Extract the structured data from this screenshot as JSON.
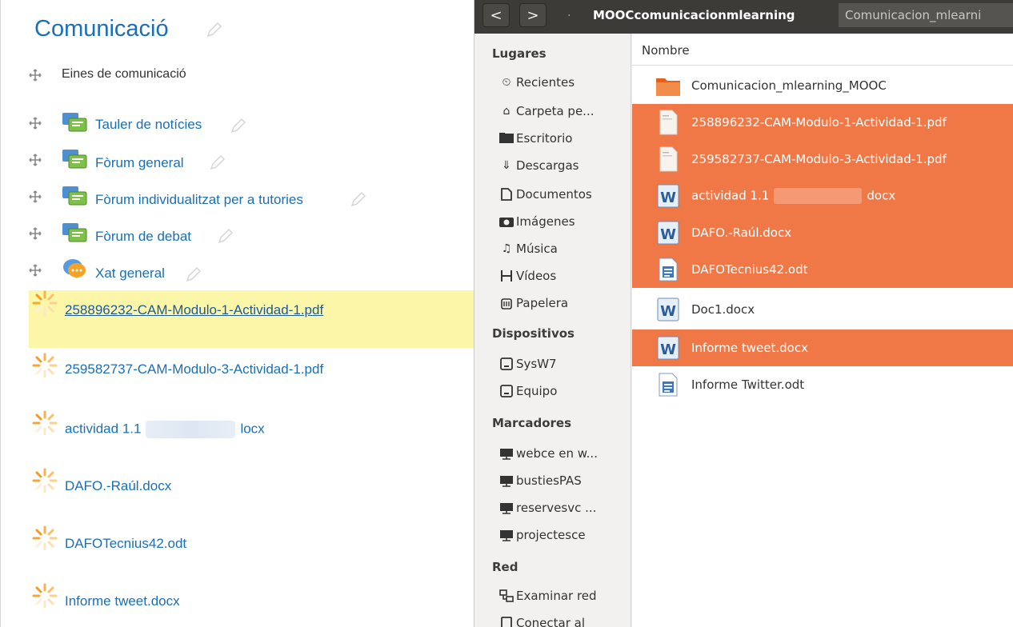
{
  "moodle": {
    "section_title": "Comunicació",
    "items": [
      {
        "label": "Eines de comunicació",
        "type": "label"
      },
      {
        "label": "Tauler de notícies",
        "type": "forum"
      },
      {
        "label": "Fòrum general",
        "type": "forum"
      },
      {
        "label": "Fòrum individualitzat per a tutories",
        "type": "forum"
      },
      {
        "label": "Fòrum de debat",
        "type": "forum"
      },
      {
        "label": "Xat general",
        "type": "chat"
      }
    ],
    "uploading_files": [
      {
        "label": "258896232-CAM-Modulo-1-Actividad-1.pdf"
      },
      {
        "label": "259582737-CAM-Modulo-3-Actividad-1.pdf"
      },
      {
        "label_start": "actividad 1.1",
        "label_end": "locx"
      },
      {
        "label": "DAFO.-Raúl.docx"
      },
      {
        "label": "DAFOTecnius42.odt"
      },
      {
        "label": "Informe tweet.docx"
      }
    ],
    "colors": {
      "link": "#1a6fb5",
      "highlight": "#fbf6a8"
    }
  },
  "file_manager": {
    "nav": {
      "back": "<",
      "forward": ">"
    },
    "breadcrumbs": [
      "MOOCcomunicacionmlearning",
      "Comunicacion_mlearni"
    ],
    "sidebar": {
      "sections": [
        {
          "heading": "Lugares",
          "items": [
            {
              "label": "Recientes",
              "icon": "clock-icon"
            },
            {
              "label": "Carpeta pe...",
              "icon": "home-icon"
            },
            {
              "label": "Escritorio",
              "icon": "desktop-icon"
            },
            {
              "label": "Descargas",
              "icon": "download-icon"
            },
            {
              "label": "Documentos",
              "icon": "document-icon"
            },
            {
              "label": "Imágenes",
              "icon": "camera-icon"
            },
            {
              "label": "Música",
              "icon": "music-icon"
            },
            {
              "label": "Vídeos",
              "icon": "film-icon"
            },
            {
              "label": "Papelera",
              "icon": "trash-icon"
            }
          ]
        },
        {
          "heading": "Dispositivos",
          "items": [
            {
              "label": "SysW7",
              "icon": "drive-icon"
            },
            {
              "label": "Equipo",
              "icon": "drive-icon"
            }
          ]
        },
        {
          "heading": "Marcadores",
          "items": [
            {
              "label": "webce en w...",
              "icon": "network-folder-icon"
            },
            {
              "label": "bustiesPAS",
              "icon": "network-folder-icon"
            },
            {
              "label": "reservesvc ...",
              "icon": "network-folder-icon"
            },
            {
              "label": "projectesce",
              "icon": "network-folder-icon"
            }
          ]
        },
        {
          "heading": "Red",
          "items": [
            {
              "label": "Examinar red",
              "icon": "network-icon"
            },
            {
              "label": "Conectar al",
              "icon": "server-icon"
            }
          ]
        }
      ]
    },
    "column_header": "Nombre",
    "files": [
      {
        "name": "Comunicacion_mlearning_MOOC",
        "icon": "folder-icon",
        "selected": false
      },
      {
        "name": "258896232-CAM-Modulo-1-Actividad-1.pdf",
        "icon": "pdf-icon",
        "selected": true
      },
      {
        "name": "259582737-CAM-Modulo-3-Actividad-1.pdf",
        "icon": "pdf-icon",
        "selected": true
      },
      {
        "name_start": "actividad 1.1",
        "name_end": "docx",
        "icon": "word-icon",
        "selected": true
      },
      {
        "name": "DAFO.-Raúl.docx",
        "icon": "word-icon",
        "selected": true
      },
      {
        "name": "DAFOTecnius42.odt",
        "icon": "writer-icon",
        "selected": true
      },
      {
        "name": "Doc1.docx",
        "icon": "word-icon",
        "selected": false
      },
      {
        "name": "Informe tweet.docx",
        "icon": "word-icon",
        "selected": true
      },
      {
        "name": "Informe Twitter.odt",
        "icon": "writer-icon",
        "selected": false
      }
    ],
    "colors": {
      "selection": "#f07746",
      "titlebar": "#3c3b37"
    }
  }
}
